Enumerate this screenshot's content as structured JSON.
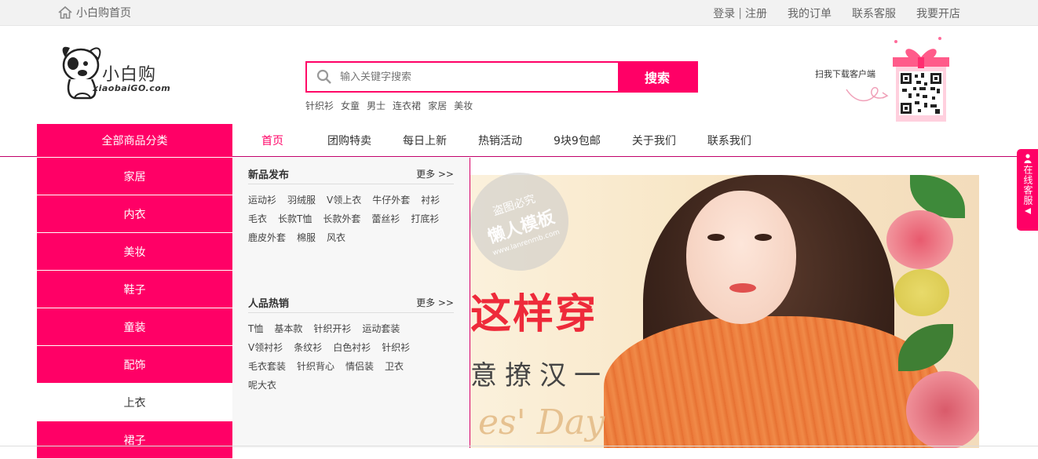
{
  "topbar": {
    "home_label": "小白购首页",
    "login": "登录",
    "separator": "|",
    "register": "注册",
    "orders": "我的订单",
    "service": "联系客服",
    "open_shop": "我要开店"
  },
  "logo": {
    "text": "小白购",
    "sub": "xiaobaiGO.com"
  },
  "search": {
    "placeholder": "输入关键字搜索",
    "button": "搜索"
  },
  "hot_words": [
    "针织衫",
    "女童",
    "男士",
    "连衣裙",
    "家居",
    "美妆"
  ],
  "qr": {
    "label": "扫我下载客户端"
  },
  "nav": {
    "all_categories": "全部商品分类",
    "items": [
      "首页",
      "团购特卖",
      "每日上新",
      "热销活动",
      "9块9包邮",
      "关于我们",
      "联系我们"
    ]
  },
  "sidebar": {
    "items": [
      "家居",
      "内衣",
      "美妆",
      "鞋子",
      "童装",
      "配饰",
      "上衣",
      "裙子"
    ]
  },
  "panel": {
    "sections": [
      {
        "title": "新品发布",
        "more": "更多 >>",
        "links": [
          "运动衫",
          "羽绒服",
          "V领上衣",
          "牛仔外套",
          "衬衫",
          "毛衣",
          "长款T恤",
          "长款外套",
          "蕾丝衫",
          "打底衫",
          "鹿皮外套",
          "棉服",
          "风衣"
        ]
      },
      {
        "title": "人品热销",
        "more": "更多 >>",
        "links": [
          "T恤",
          "基本款",
          "针织开衫",
          "运动套装",
          "V领衬衫",
          "条纹衫",
          "白色衬衫",
          "针织衫",
          "毛衣套装",
          "针织背心",
          "情侣装",
          "卫衣",
          "呢大衣"
        ]
      }
    ]
  },
  "banner": {
    "slogan": "这样穿",
    "slogan_sub": "意撩汉一",
    "script": "es' Day"
  },
  "watermark": {
    "line1": "盗图必究",
    "line2": "懒人模板",
    "line3": "www.lanrenmb.com"
  },
  "online_service": {
    "label": "在线客服"
  },
  "colors": {
    "brand": "#ff0066",
    "topbar_bg": "#f2f2f2",
    "panel_bg": "#f7f7f7"
  }
}
